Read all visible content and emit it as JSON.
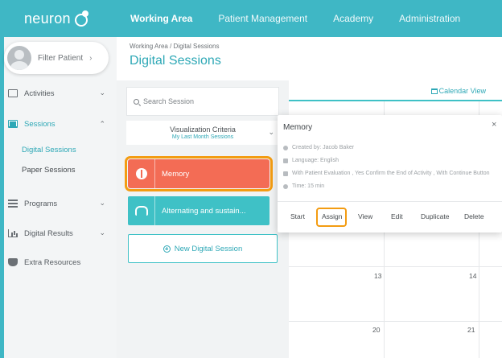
{
  "brand": {
    "logo_text": "neuron"
  },
  "topnav": {
    "items": [
      "Working Area",
      "Patient Management",
      "Academy",
      "Administration"
    ],
    "active": "Working Area"
  },
  "sidebar": {
    "filter_patient": "Filter Patient",
    "items": [
      {
        "label": "Activities",
        "icon": "activities-icon"
      },
      {
        "label": "Sessions",
        "icon": "sessions-icon"
      },
      {
        "label": "Programs",
        "icon": "programs-icon"
      },
      {
        "label": "Digital Results",
        "icon": "results-icon"
      },
      {
        "label": "Extra Resources",
        "icon": "resources-icon"
      }
    ],
    "sub_items": [
      "Digital Sessions",
      "Paper Sessions"
    ],
    "active_item": "Sessions",
    "active_sub": "Digital Sessions"
  },
  "main": {
    "breadcrumb": "Working Area / Digital Sessions",
    "title": "Digital Sessions"
  },
  "session_list": {
    "search_placeholder": "Search Session",
    "criteria_title": "Visualization Criteria",
    "criteria_value": "My Last Month Sessions",
    "sessions": [
      {
        "label": "Memory",
        "color": "#f36c55",
        "selected": true
      },
      {
        "label": "Alternating and sustain...",
        "color": "#3fc1c6",
        "selected": false
      }
    ],
    "new_session_label": "New Digital Session"
  },
  "calendar": {
    "view_label": "Calendar View",
    "day_numbers": [
      "13",
      "14",
      "20",
      "21"
    ]
  },
  "popup": {
    "title": "Memory",
    "close": "×",
    "details": [
      "Created by: Jacob Baker",
      "Language: English",
      "With Patient Evaluation , Yes Confirm the End of Activity , With Continue Button",
      "Time: 15 min"
    ],
    "actions": [
      "Start",
      "Assign",
      "View",
      "Edit",
      "Duplicate",
      "Delete"
    ],
    "highlighted_action": "Assign"
  },
  "colors": {
    "brand": "#3fb7c5",
    "accent": "#2ea8b6",
    "memory": "#f36c55",
    "highlight": "#f39c12"
  }
}
